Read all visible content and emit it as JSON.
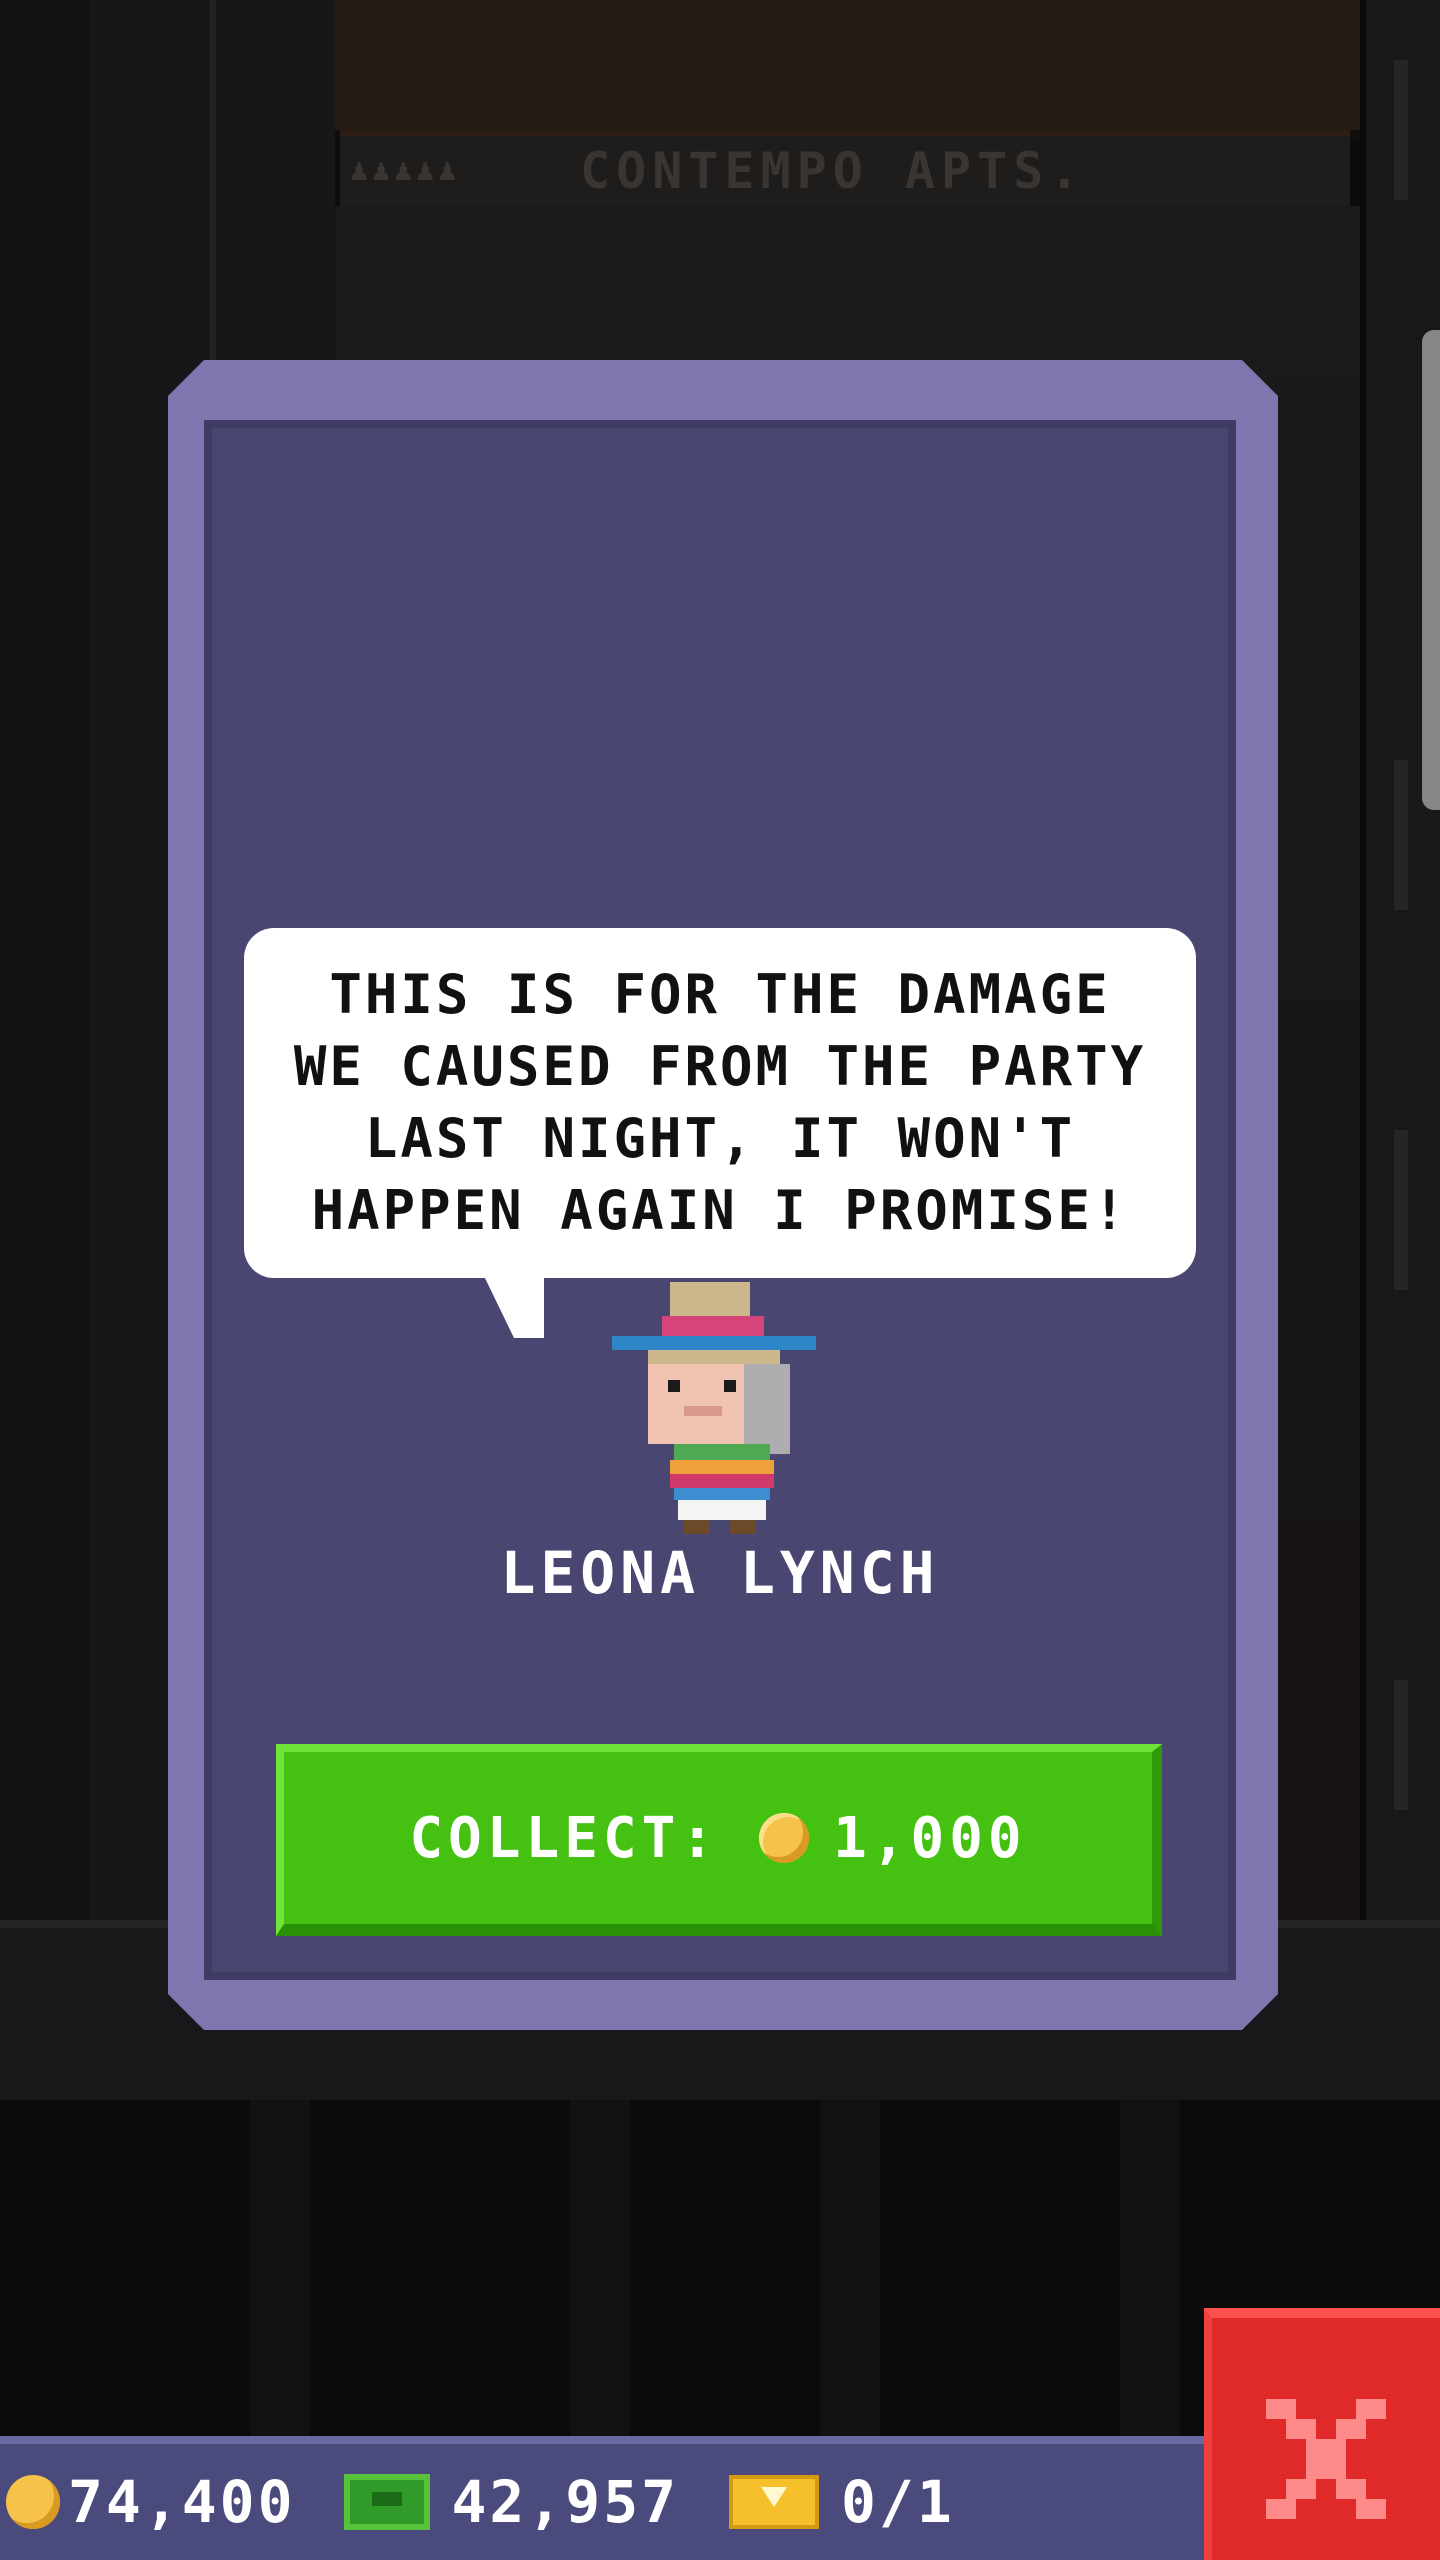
{
  "building": {
    "floor_sign": "CONTEMPO APTS."
  },
  "dialog": {
    "speech_text": "THIS IS FOR THE DAMAGE WE CAUSED FROM THE PARTY LAST NIGHT, IT WON'T HAPPEN AGAIN I PROMISE!",
    "character_name": "LEONA LYNCH",
    "collect_label": "COLLECT:",
    "collect_amount": "1,000",
    "collect_icon": "coin-icon"
  },
  "hud": {
    "coins": "74,400",
    "bux": "42,957",
    "tickets": "0/1",
    "icons": [
      "coin-icon",
      "bux-icon",
      "ticket-icon"
    ]
  },
  "close_button": {
    "icon": "close-x-icon"
  },
  "colors": {
    "card_frame": "#7f76b0",
    "card_inner": "#4a4672",
    "collect_green": "#45c211",
    "close_red": "#e02a2a",
    "hud_bar": "#4b4a7c"
  }
}
